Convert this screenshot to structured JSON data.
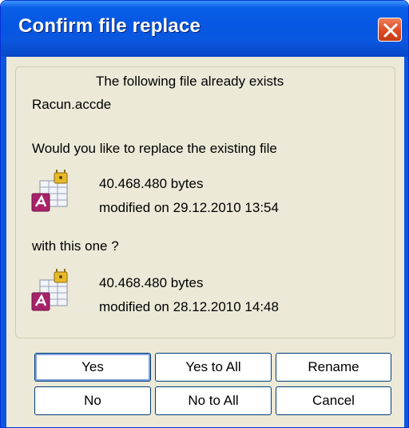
{
  "window": {
    "title": "Confirm file replace"
  },
  "message": {
    "line1": "The following file already exists",
    "filename": "Racun.accde",
    "question": "Would you like to replace the existing file",
    "existing_file": {
      "icon": "access-database-icon",
      "size": "40.468.480 bytes",
      "modified": "modified on 29.12.2010 13:54"
    },
    "with_label": "with this one ?",
    "new_file": {
      "icon": "access-database-icon",
      "size": "40.468.480 bytes",
      "modified": "modified on 28.12.2010 14:48"
    }
  },
  "buttons": {
    "yes": "Yes",
    "yes_to_all": "Yes to All",
    "rename": "Rename",
    "no": "No",
    "no_to_all": "No to All",
    "cancel": "Cancel"
  },
  "colors": {
    "titlebar": "#0556e3",
    "close_button": "#dc4a23",
    "dialog_background": "#ece9d8",
    "button_border": "#003c74"
  }
}
